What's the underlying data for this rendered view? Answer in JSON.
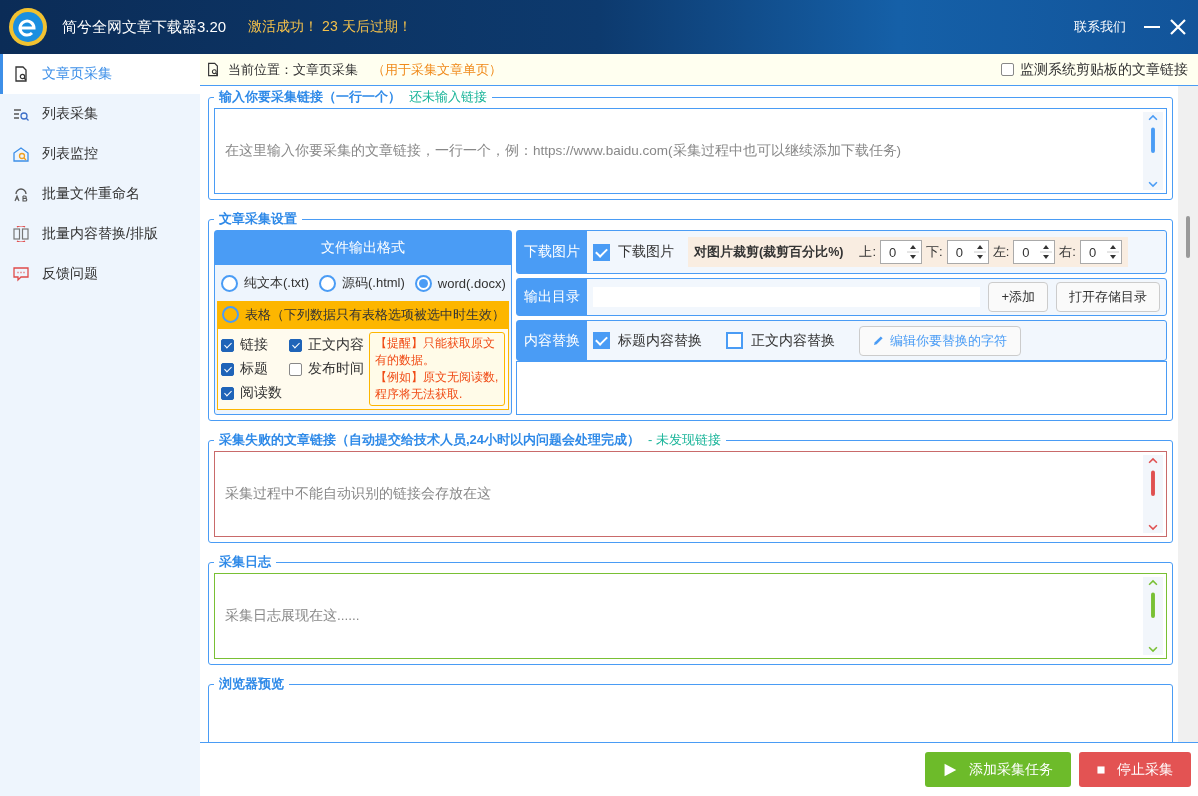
{
  "window": {
    "title": "简兮全网文章下载器3.20",
    "activation": "激活成功！ 23 天后过期！",
    "contact": "联系我们"
  },
  "sidebar": {
    "items": [
      {
        "label": "文章页采集",
        "selected": true
      },
      {
        "label": "列表采集",
        "selected": false
      },
      {
        "label": "列表监控",
        "selected": false
      },
      {
        "label": "批量文件重命名",
        "selected": false
      },
      {
        "label": "批量内容替换/排版",
        "selected": false
      },
      {
        "label": "反馈问题",
        "selected": false
      }
    ]
  },
  "breadcrumb": {
    "prefix": "当前位置：",
    "location": "文章页采集",
    "note": "（用于采集文章单页）"
  },
  "monitor_clipboard": {
    "label": "监测系统剪贴板的文章链接",
    "checked": false
  },
  "link_input": {
    "legend": "输入你要采集链接（一行一个）",
    "status": "还未输入链接",
    "placeholder": "在这里输入你要采集的文章链接，一行一个，例：https://www.baidu.com(采集过程中也可以继续添加下载任务)"
  },
  "settings": {
    "legend": "文章采集设置",
    "format": {
      "title": "文件输出格式",
      "options": [
        {
          "label": "纯文本(.txt)",
          "selected": false
        },
        {
          "label": "源码(.html)",
          "selected": false
        },
        {
          "label": "word(.docx)",
          "selected": true
        }
      ],
      "table_option": {
        "label": "表格（下列数据只有表格选项被选中时生效）",
        "selected": false
      },
      "fields": [
        {
          "label": "链接",
          "checked": true
        },
        {
          "label": "正文内容",
          "checked": true
        },
        {
          "label": "标题",
          "checked": true
        },
        {
          "label": "发布时间",
          "checked": false
        },
        {
          "label": "阅读数",
          "checked": true
        }
      ],
      "notes": [
        "【提醒】只能获取原文有的数据。",
        "【例如】原文无阅读数,程序将无法获取."
      ]
    },
    "download_images": {
      "label": "下载图片",
      "checkbox": {
        "label": "下载图片",
        "checked": true
      },
      "crop": {
        "label": "对图片裁剪(裁剪百分比%)",
        "sides": [
          {
            "label": "上:",
            "value": "0"
          },
          {
            "label": "下:",
            "value": "0"
          },
          {
            "label": "左:",
            "value": "0"
          },
          {
            "label": "右:",
            "value": "0"
          }
        ]
      }
    },
    "output_dir": {
      "label": "输出目录",
      "buttons": [
        "+添加",
        "打开存储目录"
      ]
    },
    "replace": {
      "label": "内容替换",
      "options": [
        {
          "label": "标题内容替换",
          "checked": true
        },
        {
          "label": "正文内容替换",
          "checked": false
        }
      ],
      "button": "编辑你要替换的字符"
    }
  },
  "failed": {
    "legend": "采集失败的文章链接（自动提交给技术人员,24小时以内问题会处理完成）",
    "status": "- 未发现链接",
    "placeholder": "采集过程中不能自动识别的链接会存放在这"
  },
  "log": {
    "legend": "采集日志",
    "placeholder": "采集日志展现在这......"
  },
  "preview": {
    "legend": "浏览器预览"
  },
  "actions": [
    {
      "label": "添加采集任务",
      "kind": "start"
    },
    {
      "label": "停止采集",
      "kind": "stop"
    }
  ]
}
